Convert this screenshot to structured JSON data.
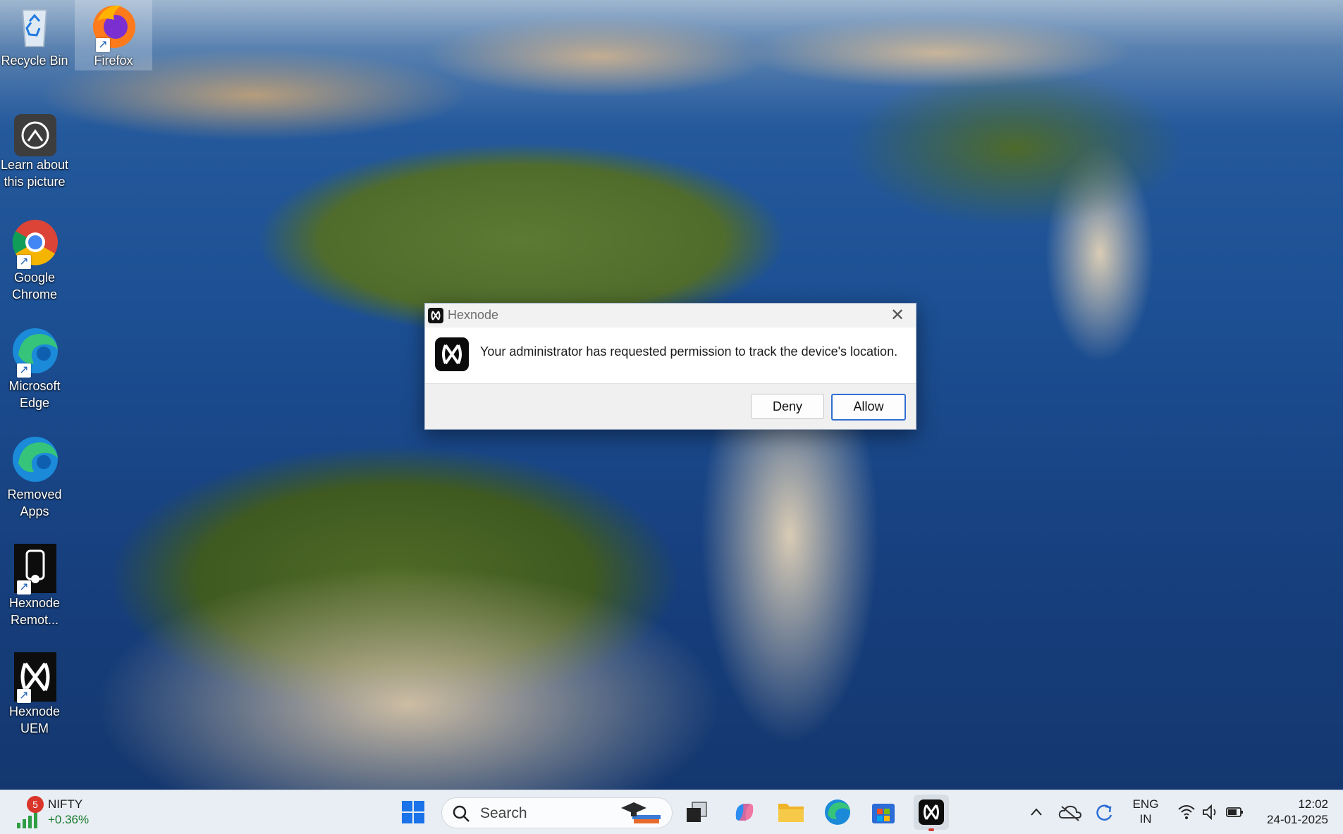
{
  "desktop": {
    "icons": [
      {
        "label": "Recycle Bin"
      },
      {
        "label": "Firefox"
      },
      {
        "label": "Learn about this picture"
      },
      {
        "label": "Google Chrome"
      },
      {
        "label": "Microsoft Edge"
      },
      {
        "label": "Removed Apps"
      },
      {
        "label": "Hexnode Remot..."
      },
      {
        "label": "Hexnode UEM"
      }
    ]
  },
  "dialog": {
    "title": "Hexnode",
    "message": "Your administrator has requested permission to track the device's location.",
    "deny_label": "Deny",
    "allow_label": "Allow"
  },
  "taskbar": {
    "widget": {
      "name": "NIFTY",
      "change": "+0.36%",
      "badge": "5"
    },
    "search_placeholder": "Search",
    "language": {
      "line1": "ENG",
      "line2": "IN"
    },
    "clock": {
      "time": "12:02",
      "date": "24-01-2025"
    }
  },
  "colors": {
    "accent": "#2f6fd1",
    "taskbar_bg": "#e9eef4",
    "dialog_title_bg": "#f2f2f2"
  }
}
